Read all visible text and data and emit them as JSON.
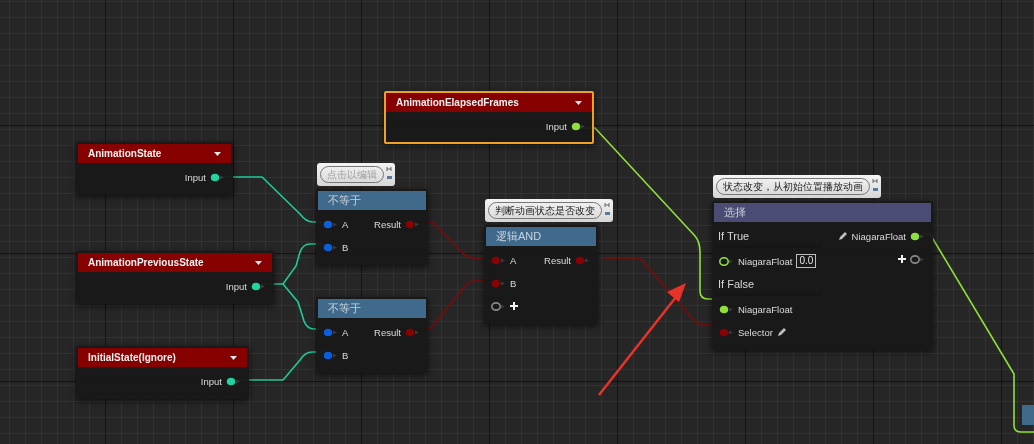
{
  "nodes": [
    {
      "kind": "parameter",
      "title": "AnimationElapsedFrames",
      "selected": true,
      "outputs": [
        {
          "kind": "pin",
          "label": "Input",
          "color": "#8fe03a",
          "connected": true
        }
      ]
    },
    {
      "kind": "parameter",
      "title": "AnimationState",
      "selected": false,
      "outputs": [
        {
          "kind": "pin",
          "label": "Input",
          "color": "#1fd6a0",
          "connected": true
        }
      ]
    },
    {
      "kind": "operation",
      "title": "不等于",
      "selected": false,
      "comment": {
        "placeholder": "点击以编辑"
      },
      "inputs": [
        {
          "kind": "pin",
          "label": "A",
          "color": "#0a5ee0",
          "connected": true
        },
        {
          "kind": "pin",
          "label": "B",
          "color": "#0a5ee0",
          "connected": true
        }
      ],
      "outputs": [
        {
          "kind": "pin",
          "label": "Result",
          "color": "#8b0000",
          "connected": true
        }
      ]
    },
    {
      "kind": "operation",
      "title": "逻辑AND",
      "selected": false,
      "comment": {
        "text": "判断动画状态是否改变"
      },
      "inputs": [
        {
          "kind": "pin",
          "label": "A",
          "color": "#8b0000",
          "connected": true
        },
        {
          "kind": "pin",
          "label": "B",
          "color": "#8b0000",
          "connected": true
        },
        {
          "kind": "add"
        }
      ],
      "outputs": [
        {
          "kind": "pin",
          "label": "Result",
          "color": "#8b0000",
          "connected": true
        }
      ]
    },
    {
      "kind": "select",
      "title": "选择",
      "selected": false,
      "comment": {
        "text": "状态改变，从初始位置播放动画"
      },
      "inputs": [
        {
          "kind": "section",
          "label": "If True"
        },
        {
          "kind": "pin",
          "label": "NiagaraFloat",
          "color": "#8fe03a",
          "connected": false,
          "value": "0.0"
        },
        {
          "kind": "section",
          "label": "If False"
        },
        {
          "kind": "pin",
          "label": "NiagaraFloat",
          "color": "#8fe03a",
          "connected": true
        },
        {
          "kind": "pin",
          "label": "Selector",
          "color": "#8b0000",
          "connected": true,
          "editable": true
        }
      ],
      "outputs": [
        {
          "kind": "pin",
          "label": "NiagaraFloat",
          "color": "#8fe03a",
          "connected": true,
          "editable": true
        },
        {
          "kind": "add"
        }
      ]
    },
    {
      "kind": "parameter",
      "title": "AnimationPreviousState",
      "selected": false,
      "outputs": [
        {
          "kind": "pin",
          "label": "Input",
          "color": "#1fd6a0",
          "connected": true
        }
      ]
    },
    {
      "kind": "operation",
      "title": "不等于",
      "selected": false,
      "inputs": [
        {
          "kind": "pin",
          "label": "A",
          "color": "#0a5ee0",
          "connected": true
        },
        {
          "kind": "pin",
          "label": "B",
          "color": "#0a5ee0",
          "connected": true
        }
      ],
      "outputs": [
        {
          "kind": "pin",
          "label": "Result",
          "color": "#8b0000",
          "connected": true
        }
      ]
    },
    {
      "kind": "parameter",
      "title": "InitialState(Ignore)",
      "selected": false,
      "outputs": [
        {
          "kind": "pin",
          "label": "Input",
          "color": "#1fd6a0",
          "connected": true
        }
      ]
    }
  ]
}
